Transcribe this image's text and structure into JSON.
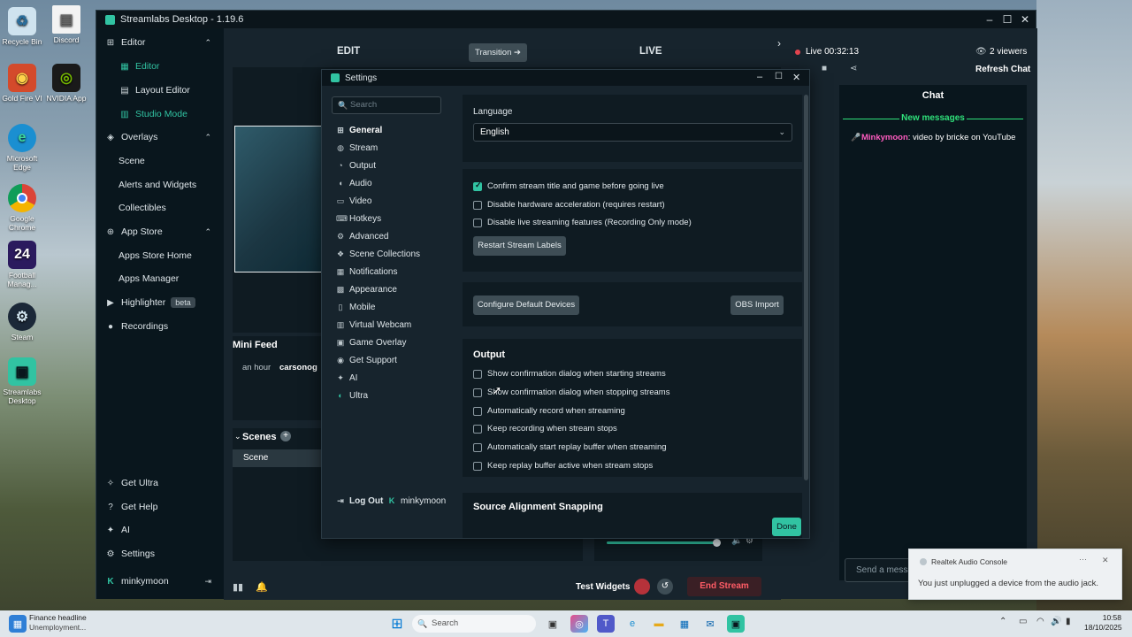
{
  "desktop": {
    "icons": [
      {
        "label": "Recycle Bin",
        "icon": "recycle-bin-icon"
      },
      {
        "label": "Discord",
        "icon": "file-icon"
      },
      {
        "label": "Gold Fire VI",
        "icon": "game-icon"
      },
      {
        "label": "NVIDIA App",
        "icon": "nvidia-icon"
      },
      {
        "label": "Microsoft Edge",
        "icon": "edge-icon"
      },
      {
        "label": "Google Chrome",
        "icon": "chrome-icon"
      },
      {
        "label": "Football Manag...",
        "icon": "football-manager-icon"
      },
      {
        "label": "Steam",
        "icon": "steam-icon"
      },
      {
        "label": "Streamlabs Desktop",
        "icon": "streamlabs-icon"
      }
    ]
  },
  "window": {
    "title": "Streamlabs Desktop - 1.19.6"
  },
  "sidebar": {
    "editor": "Editor",
    "editor_sub": [
      "Editor",
      "Layout Editor",
      "Studio Mode"
    ],
    "overlays": "Overlays",
    "overlays_sub": [
      "Scene",
      "Alerts and Widgets",
      "Collectibles"
    ],
    "app_store": "App Store",
    "app_store_sub": [
      "Apps Store Home",
      "Apps Manager"
    ],
    "highlighter": "Highlighter",
    "highlighter_badge": "beta",
    "recordings": "Recordings",
    "bottom": [
      "Get Ultra",
      "Get Help",
      "AI",
      "Settings"
    ],
    "user": "minkymoon"
  },
  "editor": {
    "edit_label": "EDIT",
    "transition_label": "Transition",
    "live_label": "LIVE",
    "mini_feed_title": "Mini Feed",
    "mini_feed_time": "an hour",
    "mini_feed_user": "carsonog",
    "scenes_title": "Scenes",
    "scene_item": "Scene"
  },
  "live": {
    "status": "Live 00:32:13",
    "viewers": "2 viewers",
    "refresh_chat": "Refresh Chat",
    "chat_title": "Chat",
    "new_messages": "New messages",
    "chat_user": "Minkymoon",
    "chat_message": ": video by bricke on YouTube",
    "send_placeholder": "Send a messa"
  },
  "bottom_bar": {
    "test_widgets": "Test Widgets",
    "end_stream": "End Stream"
  },
  "settings": {
    "title": "Settings",
    "search_placeholder": "Search",
    "nav": [
      {
        "label": "General",
        "icon": "grid-icon"
      },
      {
        "label": "Stream",
        "icon": "globe-icon"
      },
      {
        "label": "Output",
        "icon": "output-icon"
      },
      {
        "label": "Audio",
        "icon": "speaker-icon"
      },
      {
        "label": "Video",
        "icon": "monitor-icon"
      },
      {
        "label": "Hotkeys",
        "icon": "keyboard-icon"
      },
      {
        "label": "Advanced",
        "icon": "gear-icon"
      },
      {
        "label": "Scene Collections",
        "icon": "collection-icon"
      },
      {
        "label": "Notifications",
        "icon": "bell-icon"
      },
      {
        "label": "Appearance",
        "icon": "palette-icon"
      },
      {
        "label": "Mobile",
        "icon": "phone-icon"
      },
      {
        "label": "Virtual Webcam",
        "icon": "webcam-icon"
      },
      {
        "label": "Game Overlay",
        "icon": "overlay-icon"
      },
      {
        "label": "Get Support",
        "icon": "help-icon"
      },
      {
        "label": "AI",
        "icon": "sparkle-icon"
      },
      {
        "label": "Ultra",
        "icon": "ultra-icon"
      }
    ],
    "logout": "Log Out",
    "user": "minkymoon",
    "language_label": "Language",
    "language_value": "English",
    "general_checks": [
      {
        "label": "Confirm stream title and game before going live",
        "checked": true
      },
      {
        "label": "Disable hardware acceleration (requires restart)",
        "checked": false
      },
      {
        "label": "Disable live streaming features (Recording Only mode)",
        "checked": false
      }
    ],
    "restart_labels_button": "Restart Stream Labels",
    "configure_devices_button": "Configure Default Devices",
    "obs_import_button": "OBS Import",
    "output_title": "Output",
    "output_checks": [
      {
        "label": "Show confirmation dialog when starting streams",
        "checked": false
      },
      {
        "label": "Show confirmation dialog when stopping streams",
        "checked": false
      },
      {
        "label": "Automatically record when streaming",
        "checked": false
      },
      {
        "label": "Keep recording when stream stops",
        "checked": false
      },
      {
        "label": "Automatically start replay buffer when streaming",
        "checked": false
      },
      {
        "label": "Keep replay buffer active when stream stops",
        "checked": false
      }
    ],
    "source_alignment_title": "Source Alignment Snapping",
    "done_button": "Done"
  },
  "toast": {
    "app": "Realtek Audio Console",
    "message": "You just unplugged a device from the audio jack."
  },
  "taskbar": {
    "news_title": "Finance headline",
    "news_sub": "Unemployment...",
    "search_placeholder": "Search",
    "time": "10:58",
    "date": "18/10/2025"
  },
  "colors": {
    "accent": "#31c3a2",
    "background": "#17242d",
    "end_stream": "#e3454f"
  }
}
